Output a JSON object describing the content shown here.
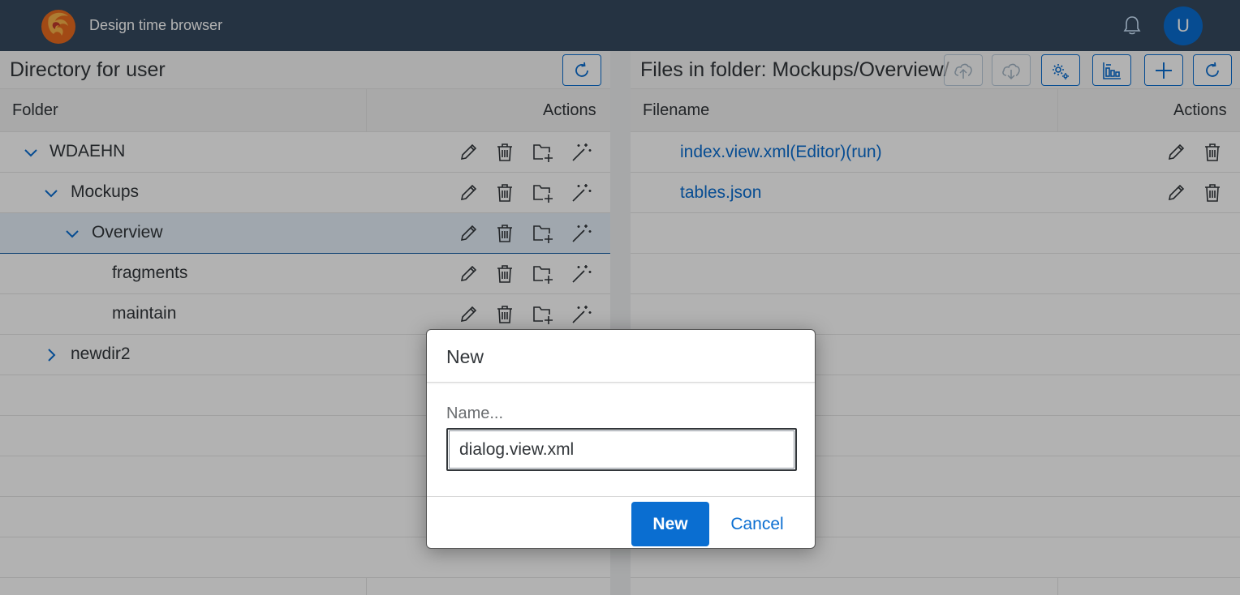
{
  "shell": {
    "app_title": "Design time browser",
    "avatar_initial": "U",
    "logo_icon": "phoenix-logo-icon",
    "bell_icon": "bell-icon"
  },
  "left_panel": {
    "title": "Directory for user",
    "refresh_icon": "refresh-icon",
    "columns": {
      "folder": "Folder",
      "actions": "Actions"
    },
    "rows": [
      {
        "label": "WDAEHN",
        "expander": "expanded",
        "selected": false
      },
      {
        "label": "Mockups",
        "expander": "expanded",
        "selected": false
      },
      {
        "label": "Overview",
        "expander": "expanded",
        "selected": true
      },
      {
        "label": "fragments",
        "expander": "none",
        "selected": false
      },
      {
        "label": "maintain",
        "expander": "none",
        "selected": false
      },
      {
        "label": "newdir2",
        "expander": "collapsed",
        "selected": false
      }
    ],
    "row_action_icons": [
      "edit-icon",
      "delete-icon",
      "new-folder-icon",
      "magic-wand-icon"
    ]
  },
  "right_panel": {
    "title": "Files in folder: Mockups/Overview/",
    "toolbar_icons": [
      "upload-icon",
      "download-icon",
      "settings-icon",
      "hierarchy-icon",
      "add-icon",
      "refresh-icon"
    ],
    "columns": {
      "filename": "Filename",
      "actions": "Actions"
    },
    "files": [
      {
        "name": "index.view.xml(Editor)(run)"
      },
      {
        "name": "tables.json"
      }
    ],
    "row_action_icons": [
      "edit-icon",
      "delete-icon"
    ]
  },
  "dialog": {
    "title": "New",
    "field_label": "Name...",
    "field_value": "dialog.view.xml",
    "confirm_label": "New",
    "cancel_label": "Cancel"
  },
  "colors": {
    "shell_bg": "#354a5f",
    "accent": "#0a6ed1",
    "selection_bg": "#e5f0fa"
  }
}
